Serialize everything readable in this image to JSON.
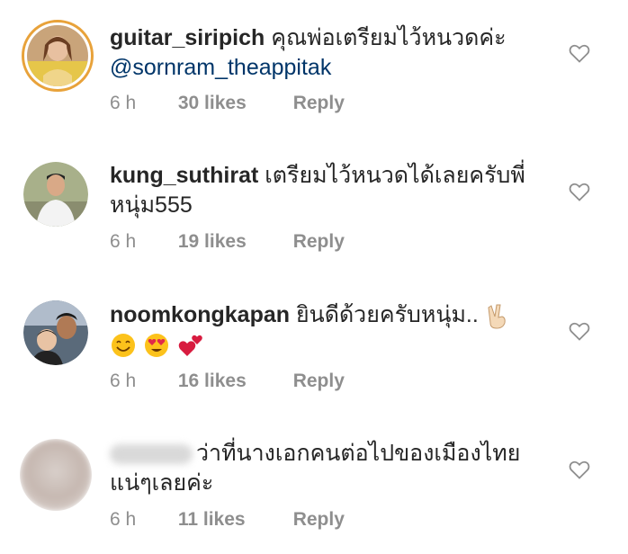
{
  "comments": [
    {
      "username": "guitar_siripich",
      "text": "คุณพ่อเตรียมไว้หนวดค่ะ",
      "mention": "@sornram_theappitak",
      "time": "6 h",
      "likes": "30 likes",
      "reply": "Reply",
      "icon": "heart-outline-icon"
    },
    {
      "username": "kung_suthirat",
      "text": "เตรียมไว้หนวดได้เลยครับพี่หนุ่ม555",
      "time": "6 h",
      "likes": "19 likes",
      "reply": "Reply",
      "icon": "heart-outline-icon"
    },
    {
      "username": "noomkongkapan",
      "text": "ยินดีด้วยครับหนุ่ม..",
      "emojis": [
        "victory-hand-emoji",
        "smiling-face-emoji",
        "heart-eyes-emoji",
        "two-hearts-emoji"
      ],
      "time": "6 h",
      "likes": "16 likes",
      "reply": "Reply",
      "icon": "heart-outline-icon"
    },
    {
      "username": "",
      "text": "ว่าที่นางเอกคนต่อไปของเมืองไทยแน่ๆเลยค่ะ",
      "time": "6 h",
      "likes": "11 likes",
      "reply": "Reply",
      "icon": "heart-outline-icon"
    }
  ],
  "colors": {
    "username": "#262626",
    "mention": "#003569",
    "meta": "#8e8e8e",
    "story_ring": "#e8a23a"
  }
}
